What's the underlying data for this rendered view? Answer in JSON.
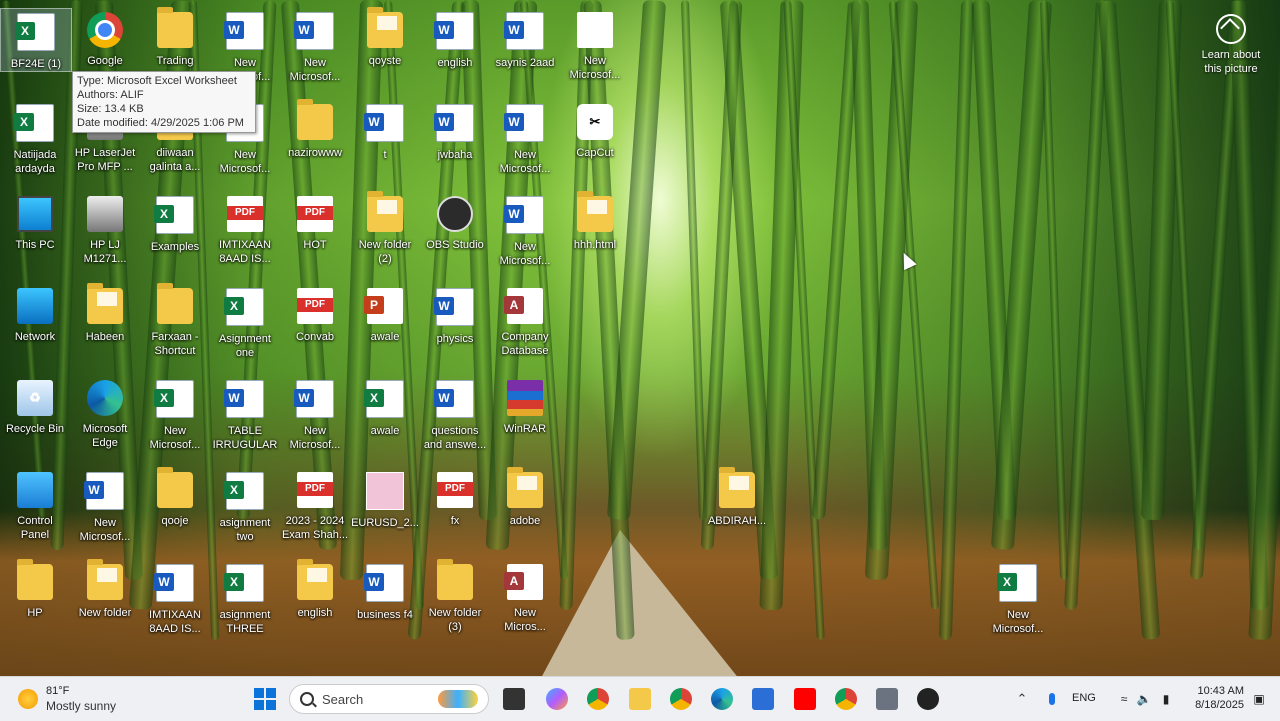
{
  "desktop": {
    "icons": [
      {
        "label": "BF24E (1)",
        "type": "excel"
      },
      {
        "label": "Google",
        "type": "chrome"
      },
      {
        "label": "Trading",
        "type": "folder"
      },
      {
        "label": "New\nMicrosof...",
        "type": "word"
      },
      {
        "label": "New\nMicrosof...",
        "type": "word"
      },
      {
        "label": "qoyste",
        "type": "folder-doc"
      },
      {
        "label": "english",
        "type": "word"
      },
      {
        "label": "saynis 2aad",
        "type": "word"
      },
      {
        "label": "New\nMicrosof...",
        "type": "blank"
      },
      {
        "label": "Natiijada\nardayda",
        "type": "excel"
      },
      {
        "label": "HP LaserJet\nPro MFP ...",
        "type": "printer"
      },
      {
        "label": "diiwaan\ngalinta a...",
        "type": "folder"
      },
      {
        "label": "New\nMicrosof...",
        "type": "word"
      },
      {
        "label": "nazirowww",
        "type": "folder"
      },
      {
        "label": "t",
        "type": "word"
      },
      {
        "label": "jwbaha",
        "type": "word"
      },
      {
        "label": "New\nMicrosof...",
        "type": "word"
      },
      {
        "label": "CapCut",
        "type": "capcut"
      },
      {
        "label": "This PC",
        "type": "pc"
      },
      {
        "label": "HP LJ\nM1271...",
        "type": "printer"
      },
      {
        "label": "Examples",
        "type": "excel"
      },
      {
        "label": "IMTIXAAN\n8AAD IS...",
        "type": "pdf"
      },
      {
        "label": "HOT",
        "type": "pdf"
      },
      {
        "label": "New folder\n(2)",
        "type": "folder-doc"
      },
      {
        "label": "OBS Studio",
        "type": "obs"
      },
      {
        "label": "New\nMicrosof...",
        "type": "word"
      },
      {
        "label": "hhh.html",
        "type": "folder-doc"
      },
      {
        "label": "Network",
        "type": "network"
      },
      {
        "label": "Habeen",
        "type": "folder-doc"
      },
      {
        "label": "Farxaan -\nShortcut",
        "type": "folder"
      },
      {
        "label": "Asignment\none",
        "type": "excel"
      },
      {
        "label": "Convab",
        "type": "pdf"
      },
      {
        "label": "awale",
        "type": "ppt"
      },
      {
        "label": "physics",
        "type": "word"
      },
      {
        "label": "Company\nDatabase",
        "type": "access"
      },
      {
        "label": "Recycle Bin",
        "type": "recycle"
      },
      {
        "label": "Microsoft\nEdge",
        "type": "edge"
      },
      {
        "label": "New\nMicrosof...",
        "type": "excel"
      },
      {
        "label": "TABLE\nIRRUGULAR",
        "type": "word"
      },
      {
        "label": "New\nMicrosof...",
        "type": "word"
      },
      {
        "label": "awale",
        "type": "excel"
      },
      {
        "label": "questions\nand answe...",
        "type": "word"
      },
      {
        "label": "WinRAR",
        "type": "winrar"
      },
      {
        "label": "Control\nPanel",
        "type": "control"
      },
      {
        "label": "New\nMicrosof...",
        "type": "word"
      },
      {
        "label": "qooje",
        "type": "folder"
      },
      {
        "label": "asignment\ntwo",
        "type": "excel"
      },
      {
        "label": "2023 - 2024\nExam Shah...",
        "type": "pdf"
      },
      {
        "label": "EURUSD_2...",
        "type": "image"
      },
      {
        "label": "fx",
        "type": "pdf"
      },
      {
        "label": "adobe",
        "type": "folder-doc"
      },
      {
        "label": "ABDIRAH...",
        "type": "folder-doc"
      },
      {
        "label": "HP",
        "type": "folder"
      },
      {
        "label": "New folder",
        "type": "folder-doc"
      },
      {
        "label": "IMTIXAAN\n8AAD IS...",
        "type": "word"
      },
      {
        "label": "asignment\nTHREE",
        "type": "excel"
      },
      {
        "label": "english",
        "type": "folder-doc"
      },
      {
        "label": "business f4",
        "type": "word"
      },
      {
        "label": "New folder\n(3)",
        "type": "folder"
      },
      {
        "label": "New\nMicros...",
        "type": "access"
      },
      {
        "label": "New\nMicrosof...",
        "type": "excel"
      }
    ],
    "tooltip": {
      "type": "Type: Microsoft Excel Worksheet",
      "authors": "Authors: ALIF",
      "size": "Size: 13.4 KB",
      "modified": "Date modified: 4/29/2025 1:06 PM"
    },
    "learn": {
      "label": "Learn about\nthis picture"
    }
  },
  "taskbar": {
    "weather": {
      "temp": "81°F",
      "desc": "Mostly sunny"
    },
    "search_placeholder": "Search",
    "apps": [
      "file-manager-icon",
      "copilot-icon",
      "chrome-icon",
      "folder-icon",
      "chrome-icon",
      "edge-icon",
      "store-icon",
      "youtube-icon",
      "chrome-icon",
      "settings-icon",
      "game-icon"
    ],
    "lang": "ENG",
    "time": "10:43 AM",
    "date": "8/18/2025"
  }
}
